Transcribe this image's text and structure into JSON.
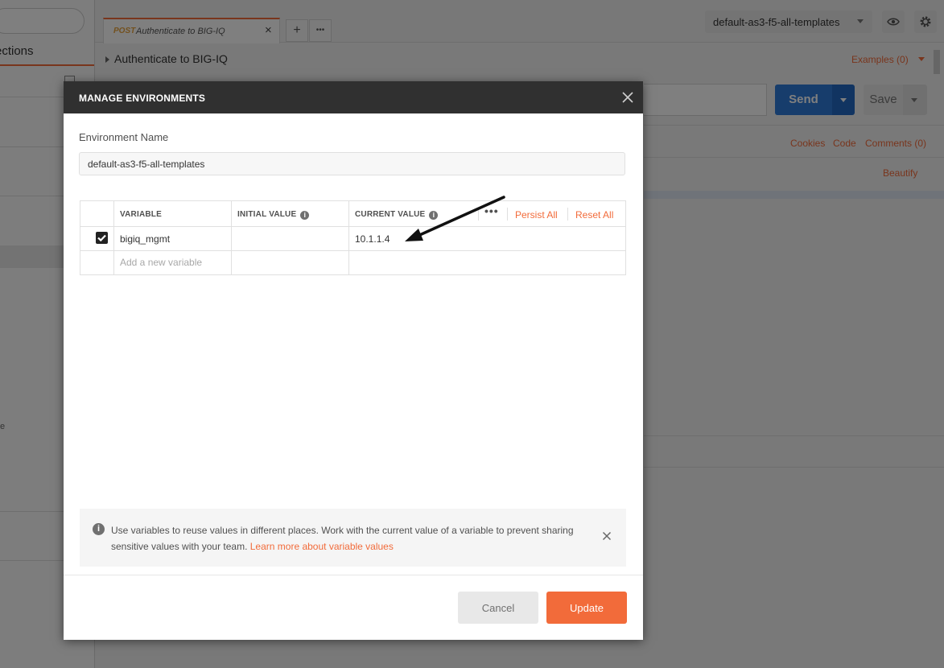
{
  "sidebar": {
    "tab_fragment": "ections",
    "text_fragment": "e"
  },
  "request_tab": {
    "method": "POST",
    "name": "Authenticate to BIG-IQ",
    "close": "×"
  },
  "tab_actions": {
    "add": "+",
    "more": "•••"
  },
  "environment_selector": {
    "selected": "default-as3-f5-all-templates"
  },
  "request": {
    "breadcrumb": "Authenticate to BIG-IQ",
    "examples_label": "Examples (0)",
    "send_label": "Send",
    "save_label": "Save",
    "cookies_label": "Cookies",
    "code_label": "Code",
    "comments_label": "Comments (0)",
    "beautify_label": "Beautify"
  },
  "modal": {
    "title": "MANAGE ENVIRONMENTS",
    "env_name_label": "Environment Name",
    "env_name_value": "default-as3-f5-all-templates",
    "table": {
      "headers": {
        "variable": "VARIABLE",
        "initial": "INITIAL VALUE",
        "current": "CURRENT VALUE",
        "more": "•••",
        "persist_all": "Persist All",
        "reset_all": "Reset All"
      },
      "rows": [
        {
          "enabled": true,
          "variable": "bigiq_mgmt",
          "initial_value": "",
          "current_value": "10.1.1.4"
        }
      ],
      "new_variable_placeholder": "Add a new variable"
    },
    "info": {
      "text": "Use variables to reuse values in different places. Work with the current value of a variable to prevent sharing sensitive values with your team.",
      "link": "Learn more about variable values"
    },
    "cancel_label": "Cancel",
    "update_label": "Update"
  },
  "colors": {
    "accent": "#f26b3a",
    "send_blue": "#2f7bd8",
    "header_dark": "#303030"
  },
  "icons": [
    "close-icon",
    "info-icon",
    "eye-icon",
    "gear-icon",
    "checkbox-checked-icon",
    "arrow-annotation-icon",
    "caret-down-icon"
  ]
}
